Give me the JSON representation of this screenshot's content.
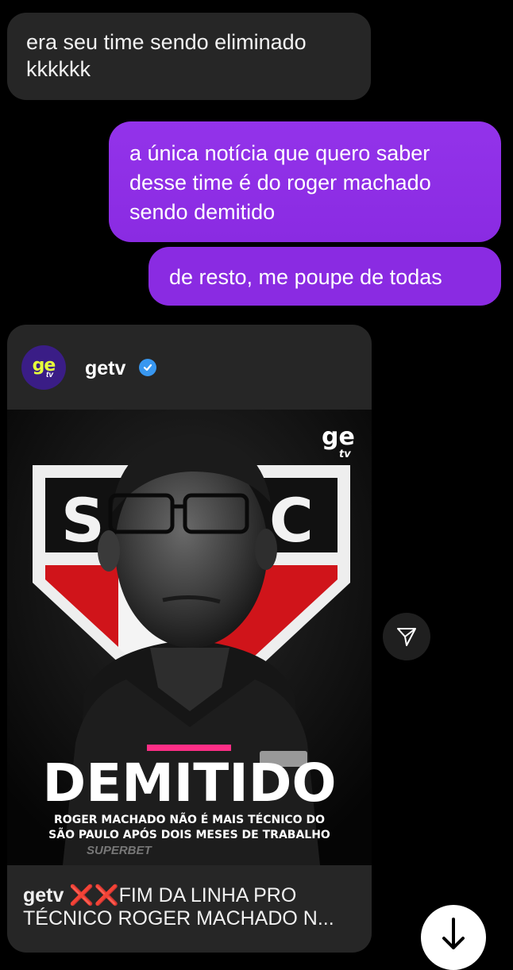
{
  "messages": {
    "incoming_1": {
      "line1": "era seu time sendo eliminado",
      "line2": "kkkkkk"
    },
    "outgoing_1": {
      "line1": "a única notícia que quero saber",
      "line2": "desse time é do roger machado",
      "line3": "sendo demitido"
    },
    "outgoing_2": {
      "text": "de resto, me poupe de todas"
    }
  },
  "post": {
    "username": "getv",
    "avatar_logo": {
      "ge": "ge",
      "tv": "tv"
    },
    "image": {
      "logo_ge": "ge",
      "logo_tv": "tv",
      "badge_letters": {
        "left": "S",
        "right": "C"
      },
      "headline": "DEMITIDO",
      "subline1": "ROGER MACHADO NÃO É MAIS TÉCNICO DO",
      "subline2": "SÃO PAULO APÓS DOIS MESES DE TRABALHO",
      "shirt_text": "SUPERBET"
    },
    "caption": {
      "user": "getv",
      "emoji": "❌❌",
      "text_line1": "FIM DA LINHA PRO",
      "text_line2": "TÉCNICO ROGER MACHADO N..."
    }
  },
  "icons": {
    "share": "send-icon",
    "scroll": "arrow-down-icon",
    "verified": "verified-badge-icon"
  },
  "colors": {
    "incoming_bubble": "#262626",
    "outgoing_bubble": "#8a2be2",
    "background": "#000000",
    "verified": "#3897f0"
  }
}
